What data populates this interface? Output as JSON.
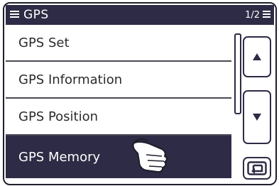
{
  "header": {
    "title": "GPS",
    "page_indicator": "1/2"
  },
  "menu": {
    "items": [
      {
        "label": "GPS Set"
      },
      {
        "label": "GPS Information"
      },
      {
        "label": "GPS Position"
      },
      {
        "label": "GPS Memory",
        "selected": true
      }
    ]
  },
  "buttons": {
    "up_icon": "up-arrow-icon",
    "down_icon": "down-arrow-icon",
    "back_icon": "return-icon"
  },
  "colors": {
    "header_bg": "#2d2b45",
    "selected_bg": "#2d2b45",
    "text": "#2b2b2b"
  }
}
